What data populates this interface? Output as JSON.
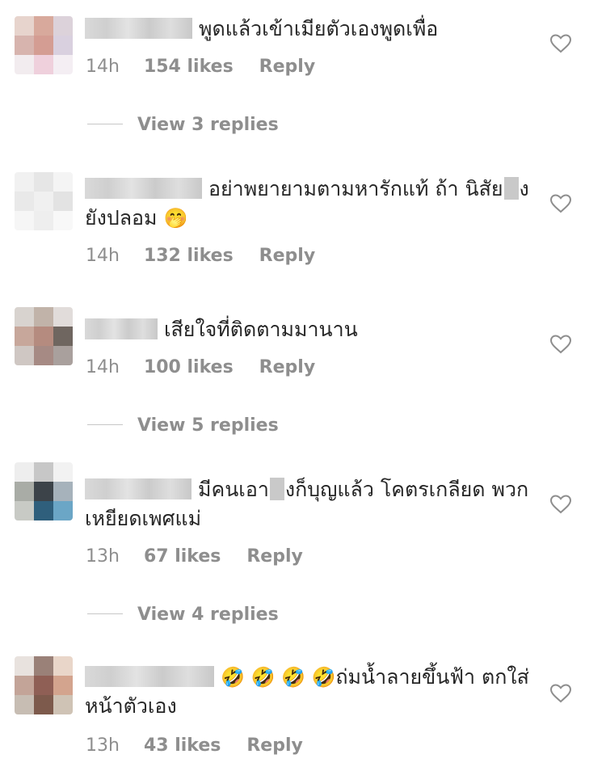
{
  "comments": [
    {
      "text": "พูดแล้วเข้าเมียตัวเองพูดเพื่อ",
      "time": "14h",
      "likes": "154 likes",
      "reply": "Reply",
      "view_replies": "View 3 replies",
      "avatar_colors": [
        "#e7d4cd",
        "#d8a99c",
        "#dcd2da",
        "#d7b4ae",
        "#d49d93",
        "#d9d0df",
        "#f2ecef",
        "#efd0dc",
        "#f4eef3"
      ]
    },
    {
      "text_part1": "อย่าพยายามตามหารักแท้ ถ้า นิสัย",
      "text_part2": "งยังปลอม",
      "emoji": "🤭",
      "time": "14h",
      "likes": "132 likes",
      "reply": "Reply",
      "avatar_colors": [
        "#f1f1f1",
        "#e6e6e6",
        "#f4f4f4",
        "#e9e9e9",
        "#f0f0f0",
        "#e3e3e3",
        "#f6f6f6",
        "#eeeeee",
        "#f8f8f8"
      ]
    },
    {
      "text": "เสียใจที่ติดตามมานาน",
      "time": "14h",
      "likes": "100 likes",
      "reply": "Reply",
      "view_replies": "View 5 replies",
      "avatar_colors": [
        "#d8d3cf",
        "#c1b3a9",
        "#e1dcda",
        "#c7a79b",
        "#b58b7f",
        "#6f6660",
        "#cfc7c3",
        "#a68a84",
        "#a9a09d"
      ]
    },
    {
      "text_part1": "มีคนเอา",
      "text_part2": "งก็บุญแล้ว โคตรเกลียด พวกเหยียดเพศแม่",
      "time": "13h",
      "likes": "67 likes",
      "reply": "Reply",
      "view_replies": "View 4 replies",
      "avatar_colors": [
        "#eeeeee",
        "#c7c7c7",
        "#f2f2f2",
        "#a9aca6",
        "#3c4349",
        "#a6b2bb",
        "#c8cac5",
        "#2f5f7c",
        "#6ba6c6"
      ]
    },
    {
      "emojis": "🤣 🤣 🤣 🤣",
      "text": "ถ่มน้ำลายขึ้นฟ้า ตกใส่หน้าตัวเอง",
      "time": "13h",
      "likes": "43 likes",
      "reply": "Reply",
      "avatar_colors": [
        "#e8e2de",
        "#9a8178",
        "#e9d6c9",
        "#c3a498",
        "#8f5f55",
        "#d3a48e",
        "#c7bdb3",
        "#7d5a4c",
        "#cfc3b5"
      ]
    }
  ],
  "icons": {
    "like": "heart-outline-icon"
  },
  "colors": {
    "text": "#262626",
    "secondary": "#8e8e8e",
    "divider": "#c7c7c7"
  }
}
